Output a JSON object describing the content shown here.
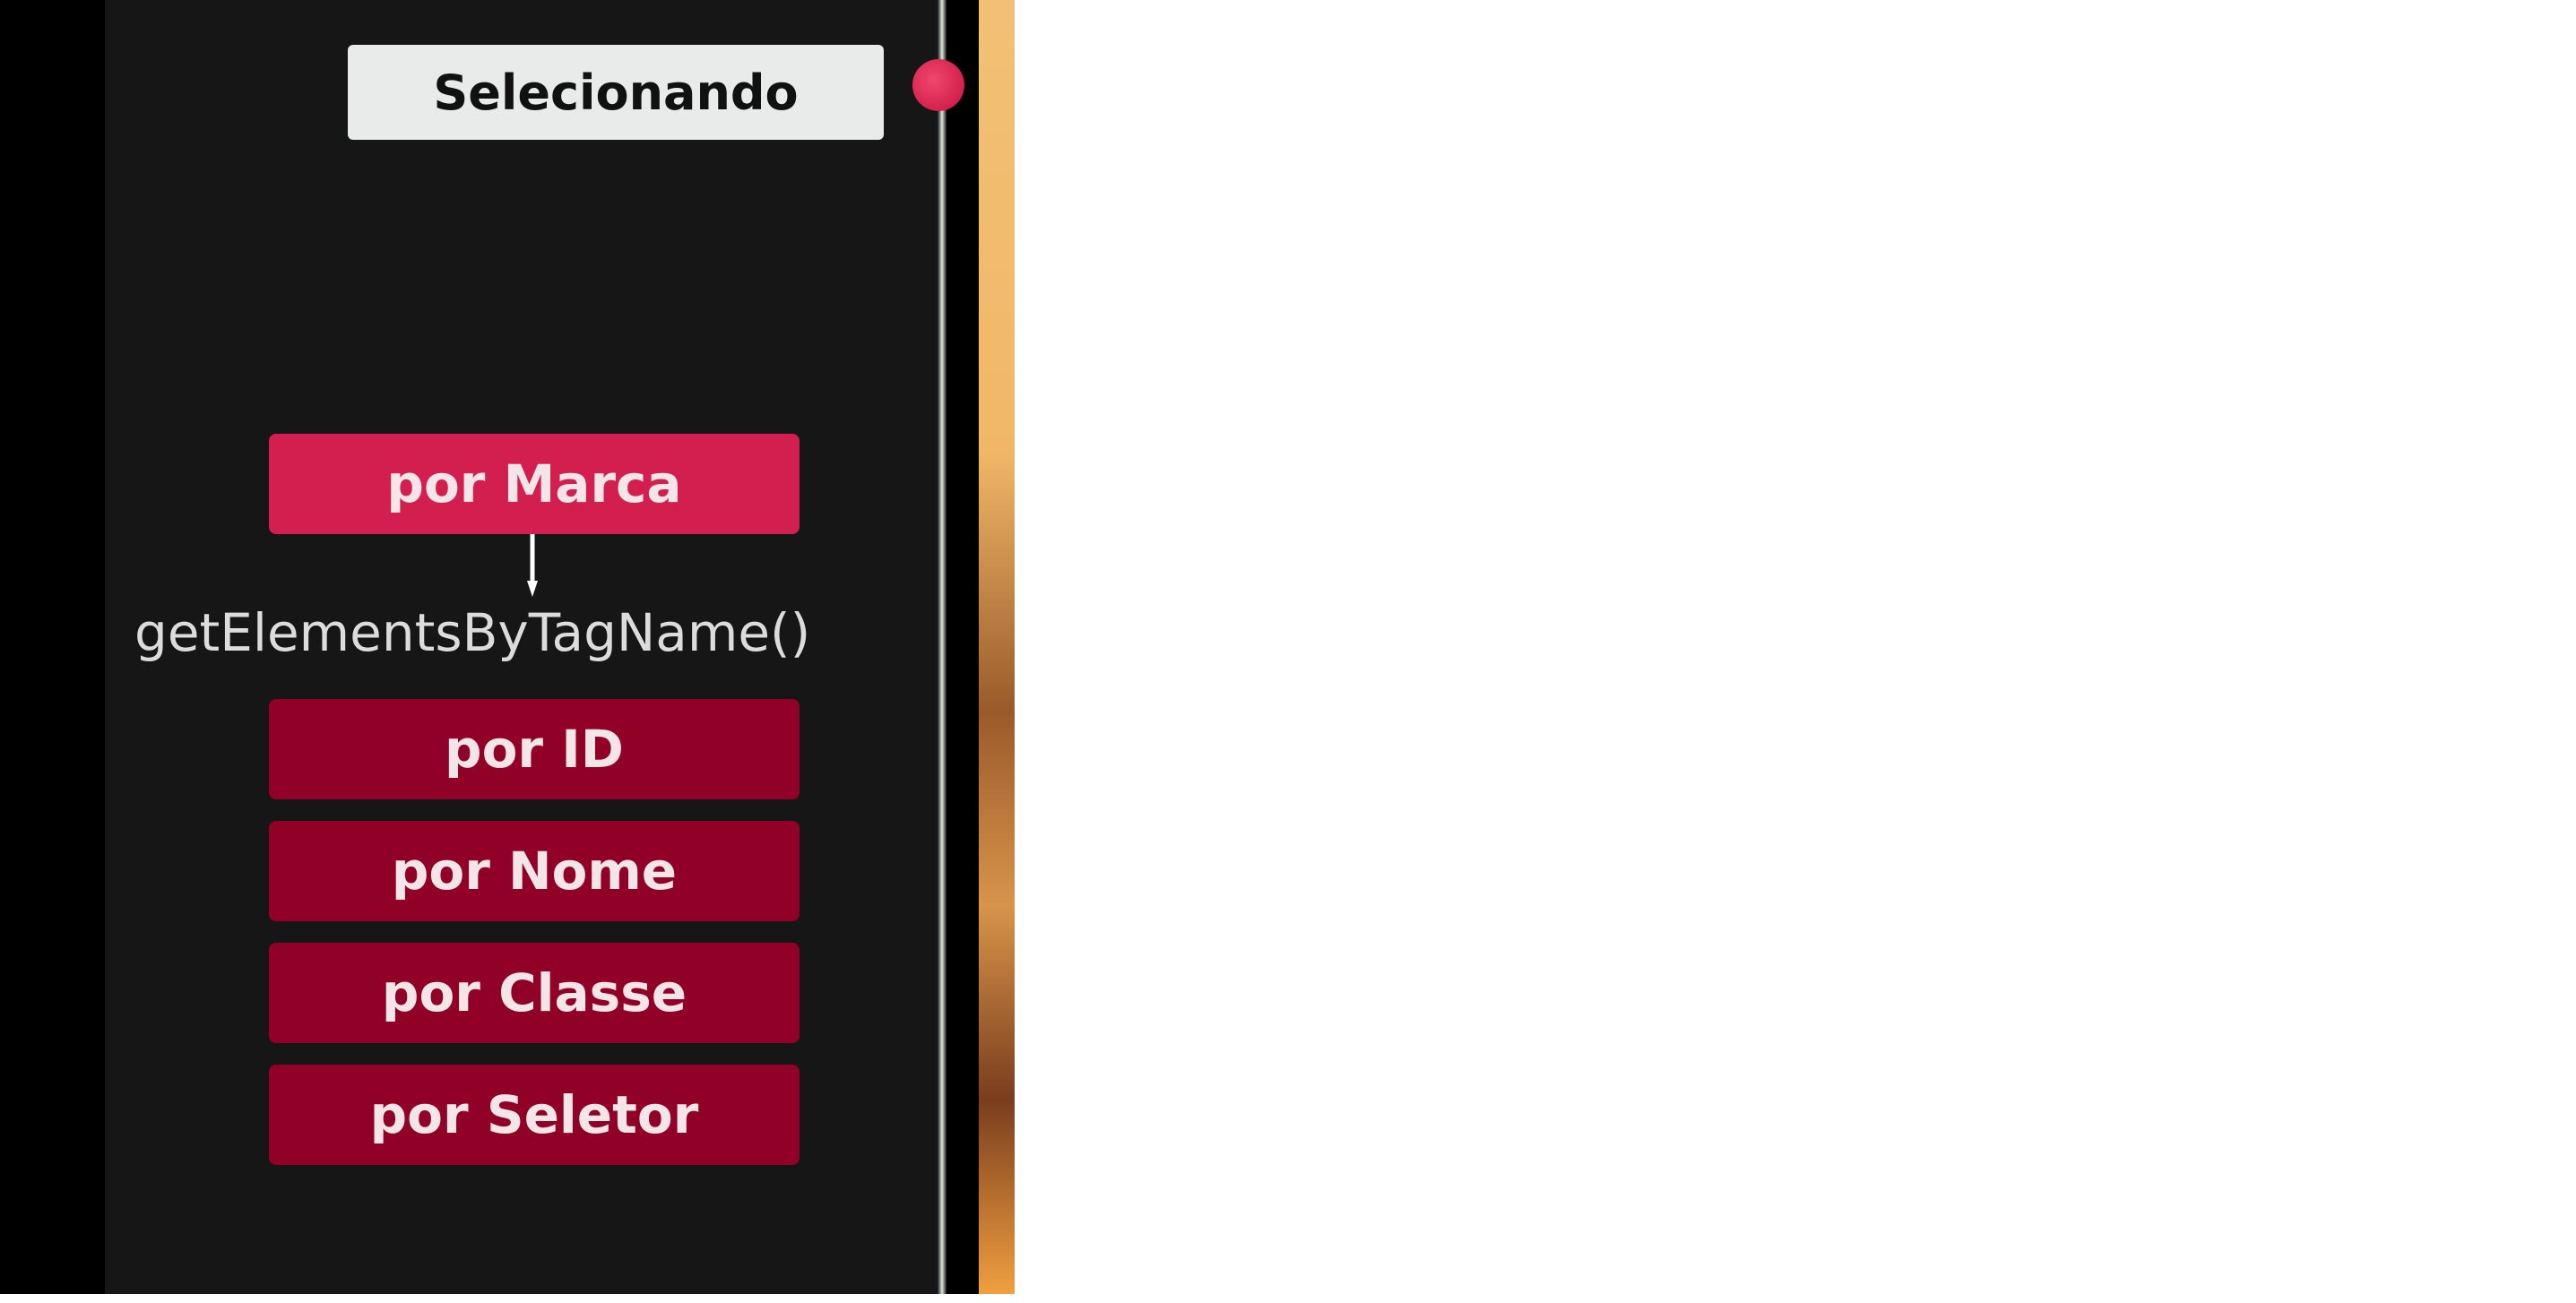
{
  "title": "Selecionando",
  "method": "getElementsByTagName()",
  "buttons": {
    "marca": "por Marca",
    "id": "por ID",
    "nome": "por Nome",
    "classe": "por Classe",
    "seletor": "por Seletor"
  },
  "colors": {
    "active": "#d21f4f",
    "inactive": "#900027",
    "background": "#161616"
  }
}
